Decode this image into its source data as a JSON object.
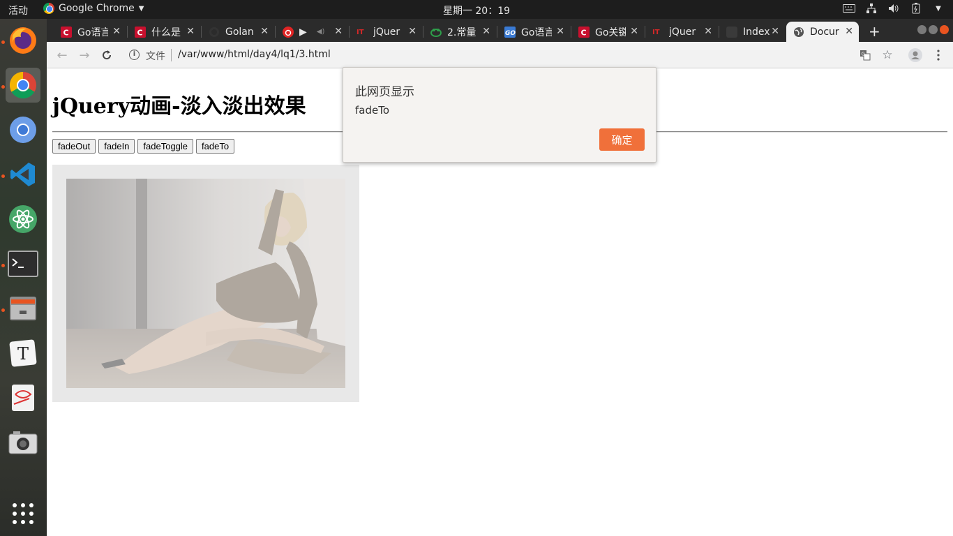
{
  "topbar": {
    "activities": "活动",
    "app_name": "Google Chrome",
    "clock": "星期一 20：19"
  },
  "tabs": [
    {
      "label": "Go语言",
      "favicon": "csdn-icon",
      "color": "#c8102e"
    },
    {
      "label": "什么是",
      "favicon": "csdn-icon",
      "color": "#c8102e"
    },
    {
      "label": "Golan",
      "favicon": "github-icon",
      "color": "#333333"
    },
    {
      "label": "",
      "favicon": "netease-music-icon",
      "color": "#e02424"
    },
    {
      "label": "jQuer",
      "favicon": "ithome-icon",
      "color": "#d62828"
    },
    {
      "label": "2.常量",
      "favicon": "frog-icon",
      "color": "#2e9e4a"
    },
    {
      "label": "Go语言",
      "favicon": "go-icon",
      "color": "#3a7bd5"
    },
    {
      "label": "Go关键",
      "favicon": "csdn-icon",
      "color": "#c8102e"
    },
    {
      "label": "jQuer",
      "favicon": "ithome-icon",
      "color": "#d62828"
    },
    {
      "label": "Index",
      "favicon": "dark-icon",
      "color": "#444444"
    },
    {
      "label": "Docur",
      "favicon": "globe-icon",
      "color": "#555555"
    }
  ],
  "address_bar": {
    "scheme_label": "文件",
    "url": "/var/www/html/day4/lq1/3.html"
  },
  "page": {
    "title": "jQuery动画-淡入淡出效果",
    "buttons": [
      "fadeOut",
      "fadeIn",
      "fadeToggle",
      "fadeTo"
    ]
  },
  "alert": {
    "title": "此网页显示",
    "message": "fadeTo",
    "ok_label": "确定",
    "ok_color": "#f0703a"
  }
}
